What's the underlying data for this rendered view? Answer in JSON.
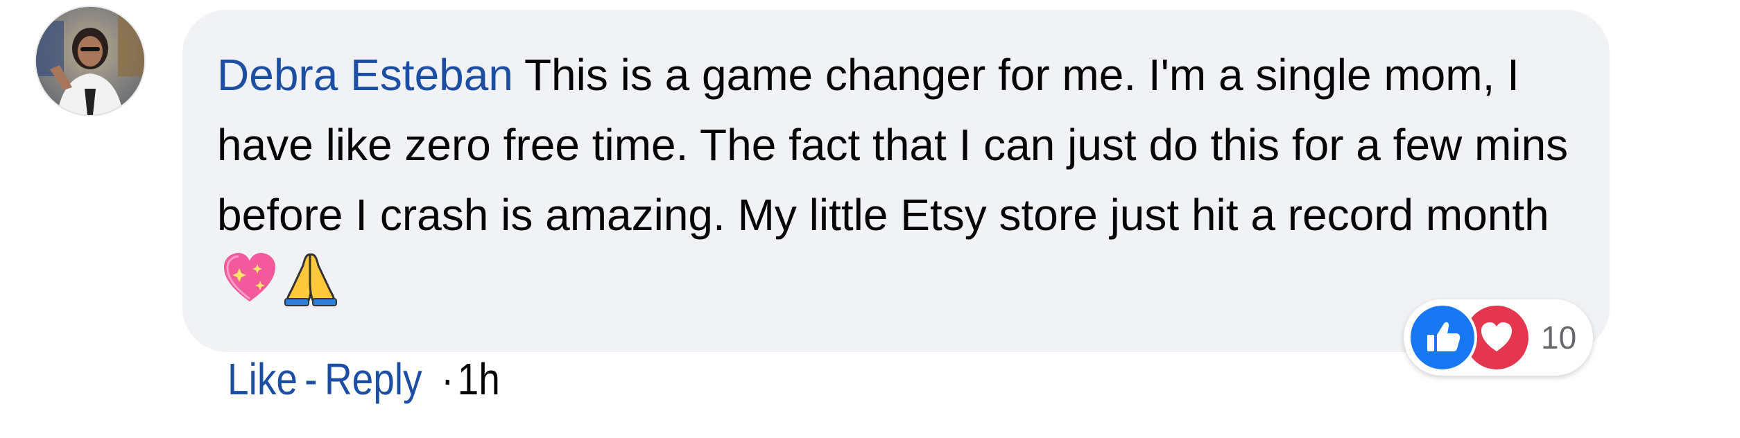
{
  "comment": {
    "author": "Debra Esteban",
    "text": "This is a game changer for me. I'm a single mom, I have like zero free time. The fact that I can just do this for a few mins before I crash is amazing. My little Etsy store just hit a record month",
    "emojis": [
      "sparkling-heart-icon",
      "folded-hands-icon"
    ]
  },
  "reactions": {
    "icons": [
      "like-icon",
      "love-icon"
    ],
    "count": "10"
  },
  "actions": {
    "like_label": "Like",
    "separator": "-",
    "reply_label": "Reply",
    "dot": "·",
    "timestamp": "1h"
  },
  "colors": {
    "author": "#1c4ea3",
    "bubble_bg": "#f0f2f5",
    "like_blue": "#1877f2",
    "love_red": "#e4364d",
    "text": "#050505"
  }
}
